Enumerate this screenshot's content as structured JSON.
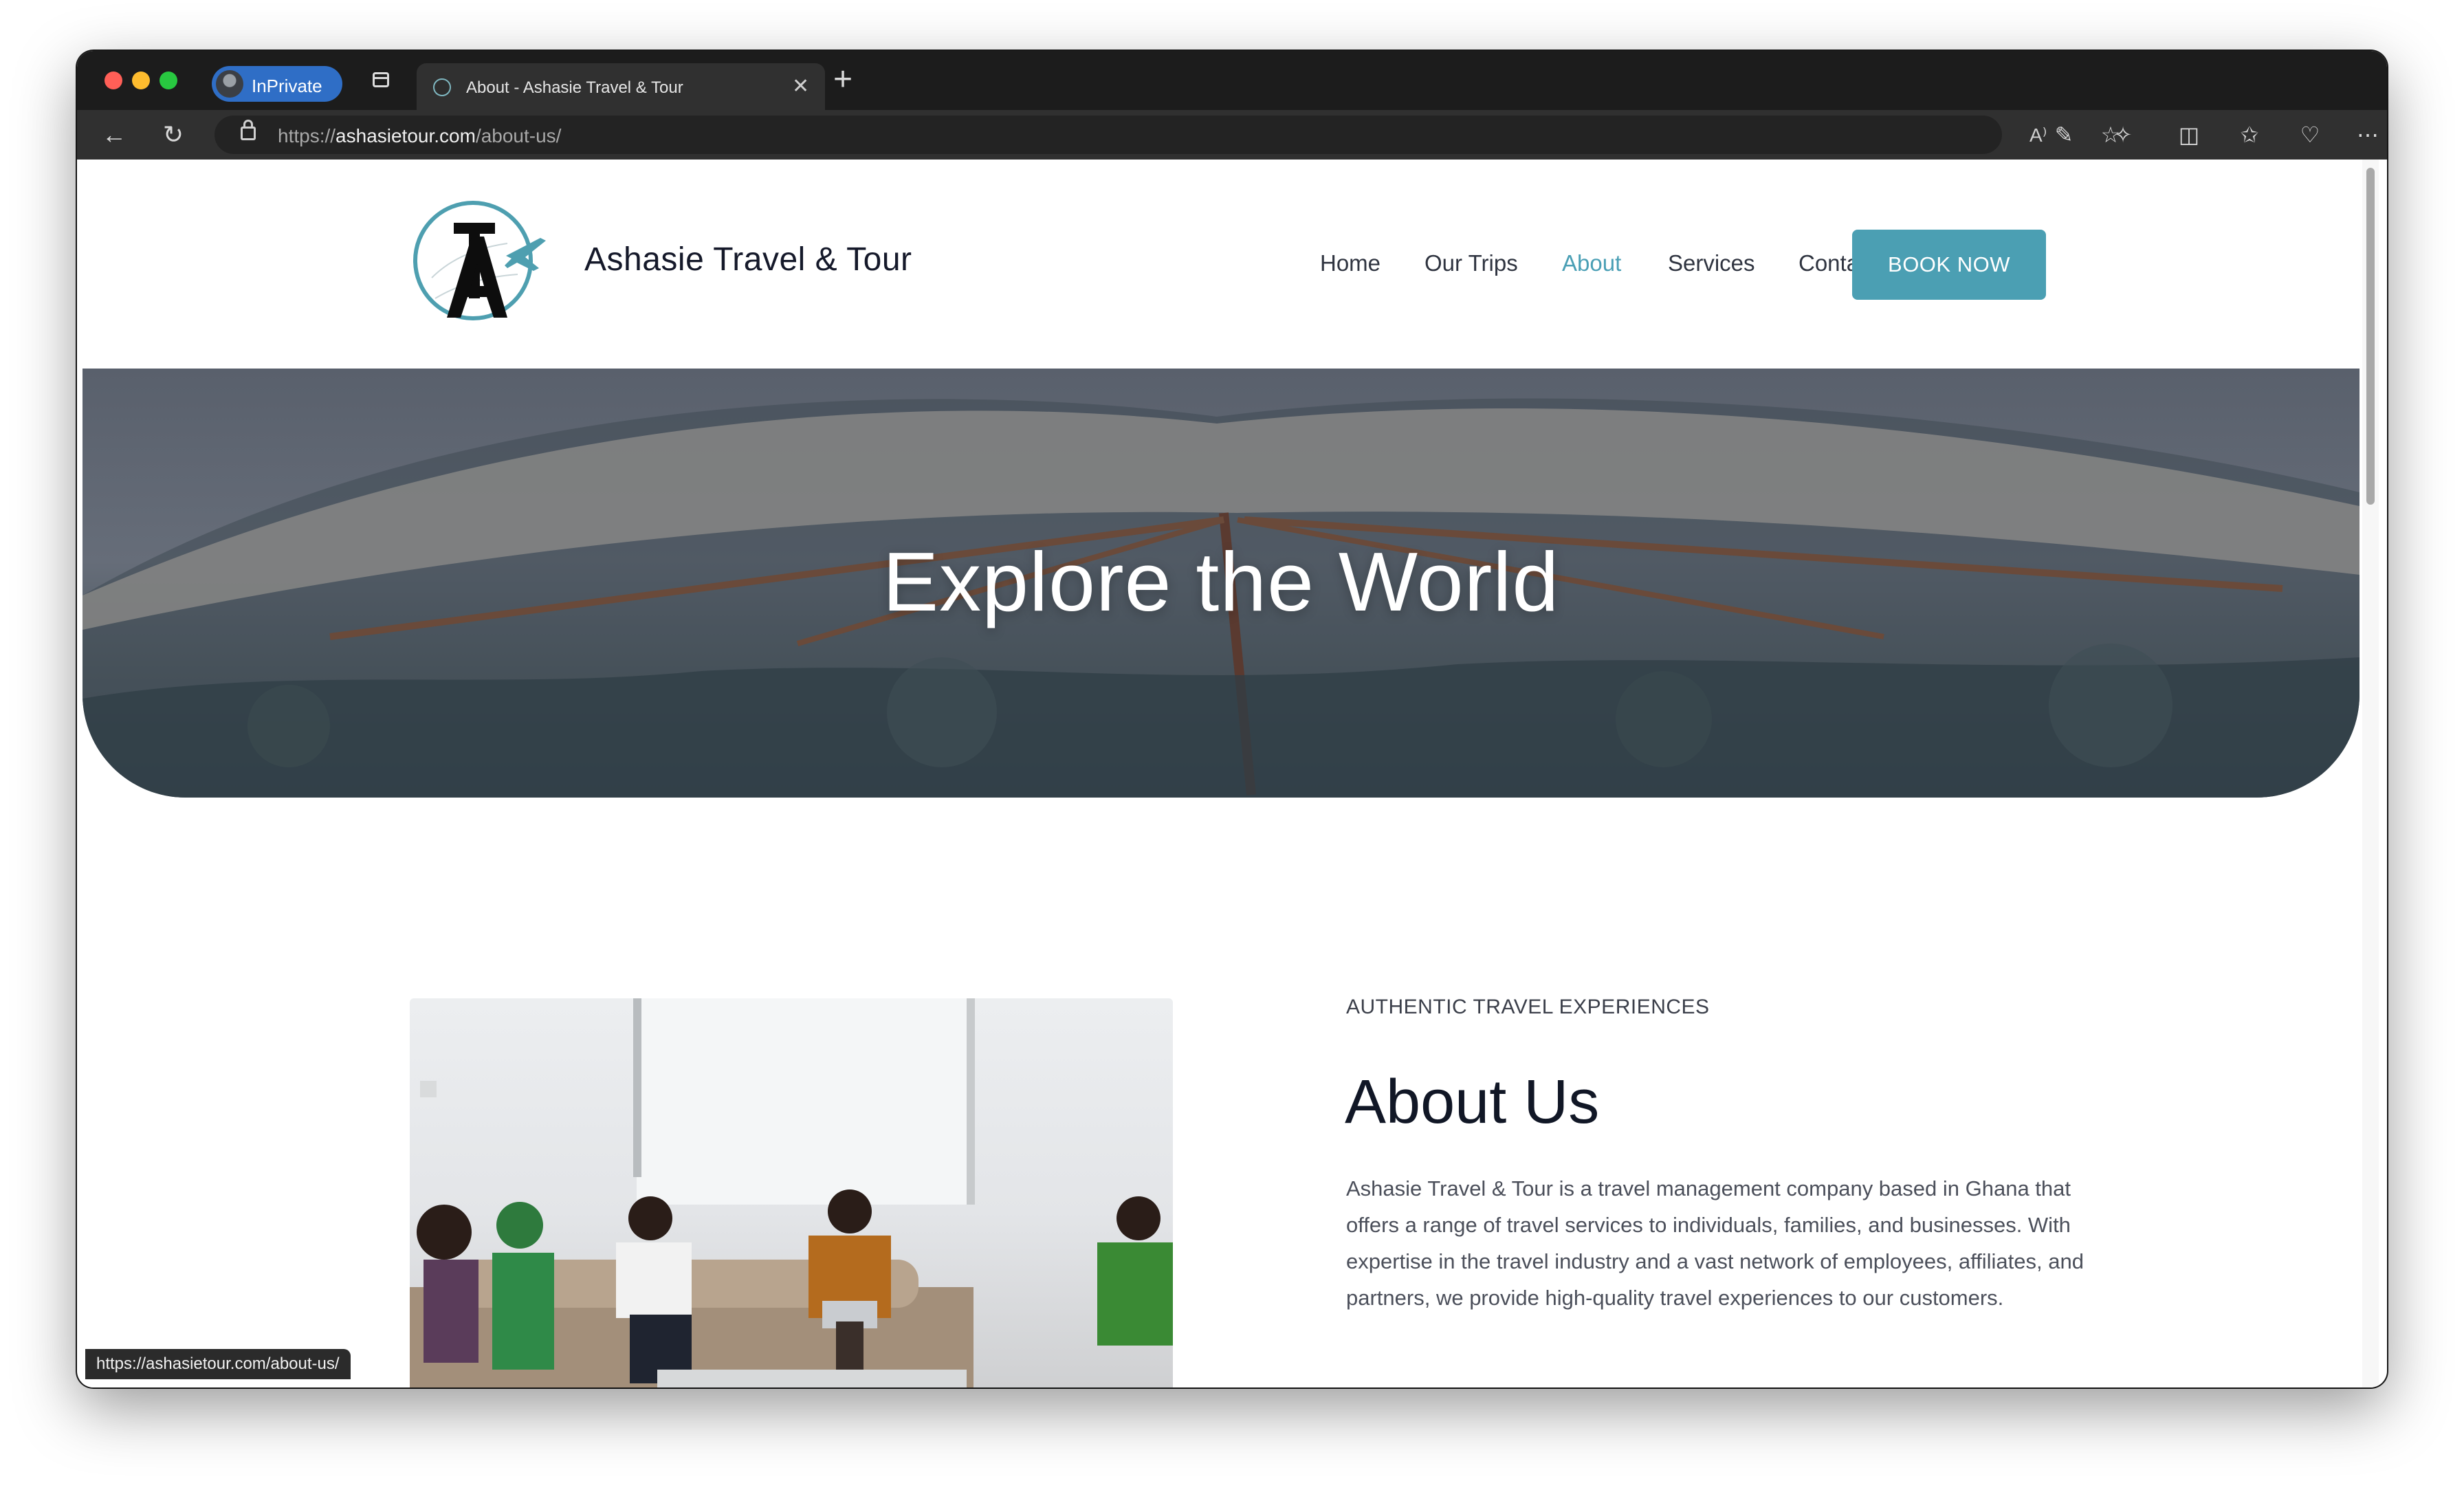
{
  "browser": {
    "inprivate_label": "InPrivate",
    "tab_title": "About - Ashasie Travel & Tour",
    "url_scheme": "https://",
    "url_host": "ashasietour.com",
    "url_path": "/about-us/",
    "read_aloud_label": "A⁾",
    "status_url": "https://ashasietour.com/about-us/"
  },
  "site": {
    "brand": "Ashasie Travel & Tour",
    "nav": [
      "Home",
      "Our Trips",
      "About",
      "Services",
      "Contact"
    ],
    "active_nav": "About",
    "cta": "BOOK NOW"
  },
  "hero": {
    "title": "Explore the World"
  },
  "about": {
    "eyebrow": "AUTHENTIC TRAVEL EXPERIENCES",
    "title": "About Us",
    "body": "Ashasie Travel & Tour is a travel management company based in Ghana that offers a range of travel services to individuals, families, and businesses. With expertise in the travel industry and a vast network of employees, affiliates, and partners, we provide high-quality travel experiences to our customers."
  },
  "colors": {
    "accent": "#4b9fb3",
    "heading": "#111726",
    "browser_chrome": "#1c1c1c"
  },
  "icons": [
    "back-arrow-icon",
    "refresh-icon",
    "lock-icon",
    "favorites-star-icon",
    "extension-icon",
    "puzzle-icon",
    "split-screen-icon",
    "collections-icon",
    "browser-essentials-icon",
    "more-icon",
    "tabs-icon",
    "close-icon",
    "plus-icon"
  ]
}
